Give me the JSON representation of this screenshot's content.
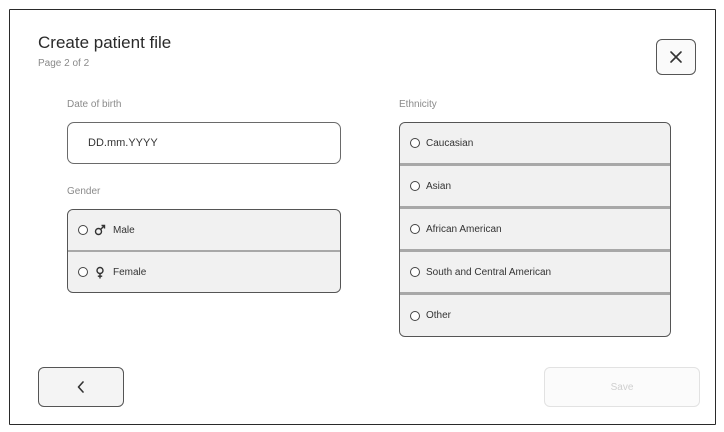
{
  "header": {
    "title": "Create patient file",
    "subtitle": "Page 2 of 2"
  },
  "date_of_birth": {
    "label": "Date of birth",
    "placeholder": "DD.mm.YYYY"
  },
  "gender": {
    "label": "Gender",
    "options": [
      {
        "label": "Male",
        "icon": "male-symbol-icon"
      },
      {
        "label": "Female",
        "icon": "female-symbol-icon"
      }
    ]
  },
  "ethnicity": {
    "label": "Ethnicity",
    "options": [
      {
        "label": "Caucasian"
      },
      {
        "label": "Asian"
      },
      {
        "label": "African American"
      },
      {
        "label": "South and Central American"
      },
      {
        "label": "Other"
      }
    ]
  },
  "footer": {
    "back_icon": "chevron-left-icon",
    "save_label": "Save"
  },
  "colors": {
    "border": "#555555",
    "option_bg": "#f1f1f1",
    "disabled_text": "#cfcfcf"
  }
}
